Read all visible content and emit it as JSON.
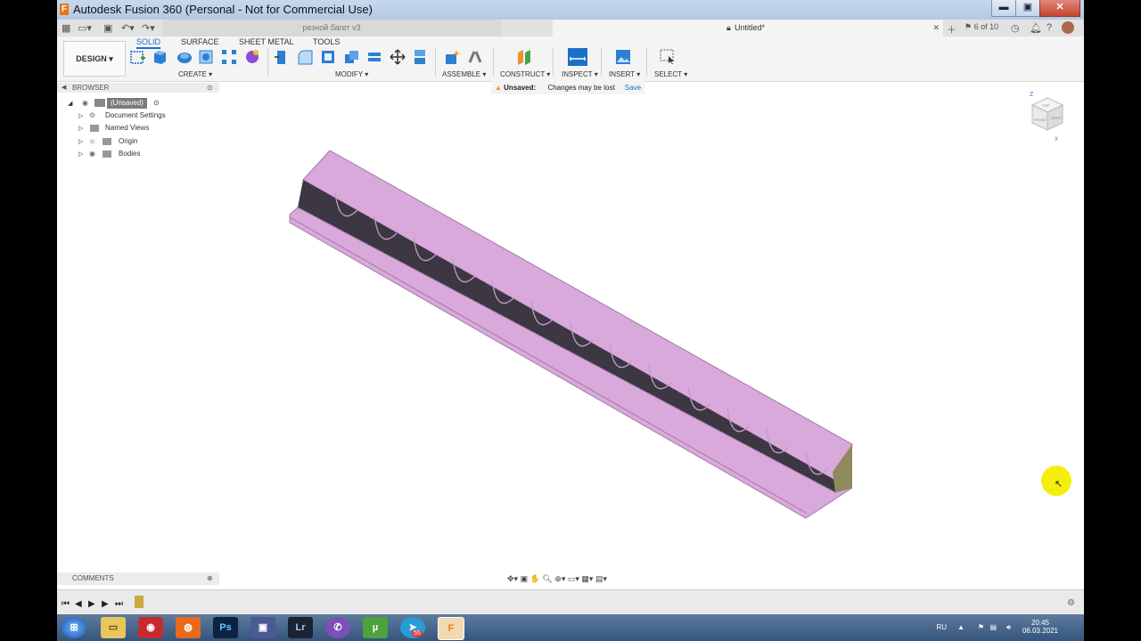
{
  "window": {
    "title": "Autodesk Fusion 360 (Personal - Not for Commercial Use)",
    "minimize": "▬",
    "maximize": "▣",
    "close": "✕"
  },
  "tabs": {
    "tab1_label": "резной багет v3",
    "tab2_label": "Untitled*",
    "job_counter": "6 of 10"
  },
  "toolbar": {
    "workspace": "DESIGN ▾",
    "tabs": [
      "SOLID",
      "SURFACE",
      "SHEET METAL",
      "TOOLS"
    ],
    "groups": {
      "create": "CREATE ▾",
      "modify": "MODIFY ▾",
      "assemble": "ASSEMBLE ▾",
      "construct": "CONSTRUCT ▾",
      "inspect": "INSPECT ▾",
      "insert": "INSERT ▾",
      "select": "SELECT ▾"
    }
  },
  "banner": {
    "status": "Unsaved:",
    "message": "Changes may be lost",
    "save_label": "Save"
  },
  "browser": {
    "title": "BROWSER",
    "root": "(Unsaved)",
    "items": [
      "Document Settings",
      "Named Views",
      "Origin",
      "Bodies"
    ]
  },
  "viewcube": {
    "top_label": "TOP",
    "front_label": "FRONT",
    "right_label": "RIGHT",
    "z_axis": "Z",
    "x_axis": "X"
  },
  "comments": {
    "title": "COMMENTS"
  },
  "taskbar": {
    "language": "RU",
    "time": "20:45",
    "date": "06.03.2021",
    "badge": "55"
  },
  "colors": {
    "accent": "#1a6fc9",
    "model": "#d9a9dc"
  }
}
